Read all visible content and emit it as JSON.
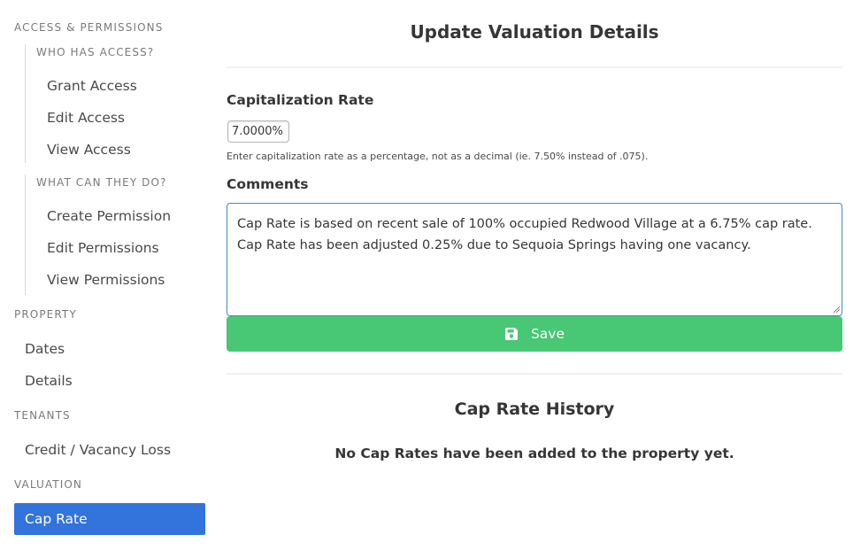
{
  "sidebar": {
    "access_label": "Access & Permissions",
    "who_label": "Who has access?",
    "who_items": [
      "Grant Access",
      "Edit Access",
      "View Access"
    ],
    "what_label": "What can they do?",
    "what_items": [
      "Create Permission",
      "Edit Permissions",
      "View Permissions"
    ],
    "property_label": "Property",
    "property_items": [
      "Dates",
      "Details"
    ],
    "tenants_label": "Tenants",
    "tenants_items": [
      "Credit / Vacancy Loss"
    ],
    "valuation_label": "Valuation",
    "valuation_items": [
      "Cap Rate"
    ],
    "active_item": "Cap Rate",
    "active_color": "#3273dc"
  },
  "main": {
    "title": "Update Valuation Details",
    "cap_rate_label": "Capitalization Rate",
    "cap_rate_value": "7.0000%",
    "cap_rate_help": "Enter capitalization rate as a percentage, not as a decimal (ie. 7.50% instead of .075).",
    "comments_label": "Comments",
    "comments_value": "Cap Rate is based on recent sale of 100% occupied Redwood Village at a 6.75% cap rate.  Cap Rate has been adjusted 0.25% due to Sequoia Springs having one vacancy.",
    "save_label": "Save",
    "save_icon": "floppy-disk-icon",
    "save_color": "#48c774",
    "history_title": "Cap Rate History",
    "history_empty": "No Cap Rates have been added to the property yet."
  }
}
